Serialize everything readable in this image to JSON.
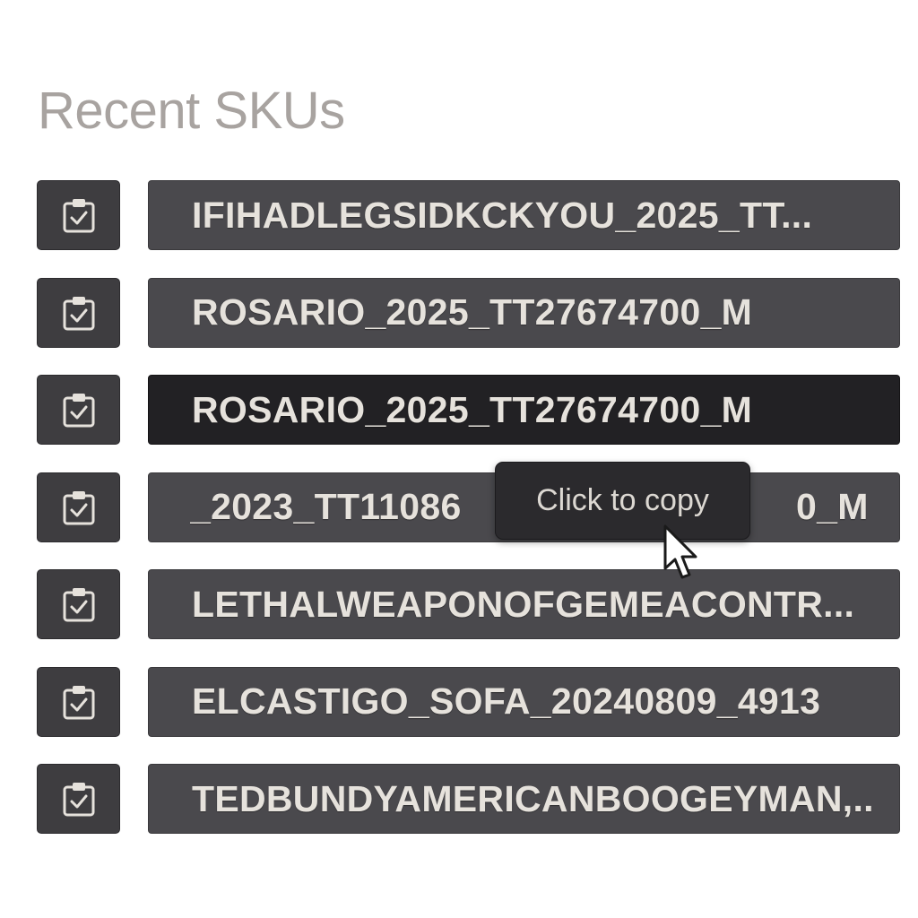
{
  "header": {
    "title": "Recent SKUs"
  },
  "skus": [
    {
      "text": "IFIHADLEGSIDKCKYOU_2025_TT...",
      "selected": false
    },
    {
      "text": "ROSARIO_2025_TT27674700_M",
      "selected": false
    },
    {
      "text": "ROSARIO_2025_TT27674700_M",
      "selected": true
    },
    {
      "text": "_2023_TT11086",
      "text_tail": "0_M",
      "selected": false
    },
    {
      "text": "LETHALWEAPONOFGEMEACONTR...",
      "selected": false
    },
    {
      "text": "ELCASTIGO_SOFA_20240809_4913",
      "selected": false
    },
    {
      "text": "TEDBUNDYAMERICANBOOGEYMAN,..",
      "selected": false
    }
  ],
  "tooltip": {
    "text": "Click to copy"
  },
  "icons": {
    "copy_button": "clipboard-check-icon",
    "pointer": "mouse-pointer-icon"
  },
  "colors": {
    "title": "#a8a3a0",
    "row_background": "#4a494d",
    "row_selected_background": "#222124",
    "button_background": "#3e3d40",
    "sku_text": "#e6e2dc",
    "tooltip_background": "#2b2a2d"
  }
}
